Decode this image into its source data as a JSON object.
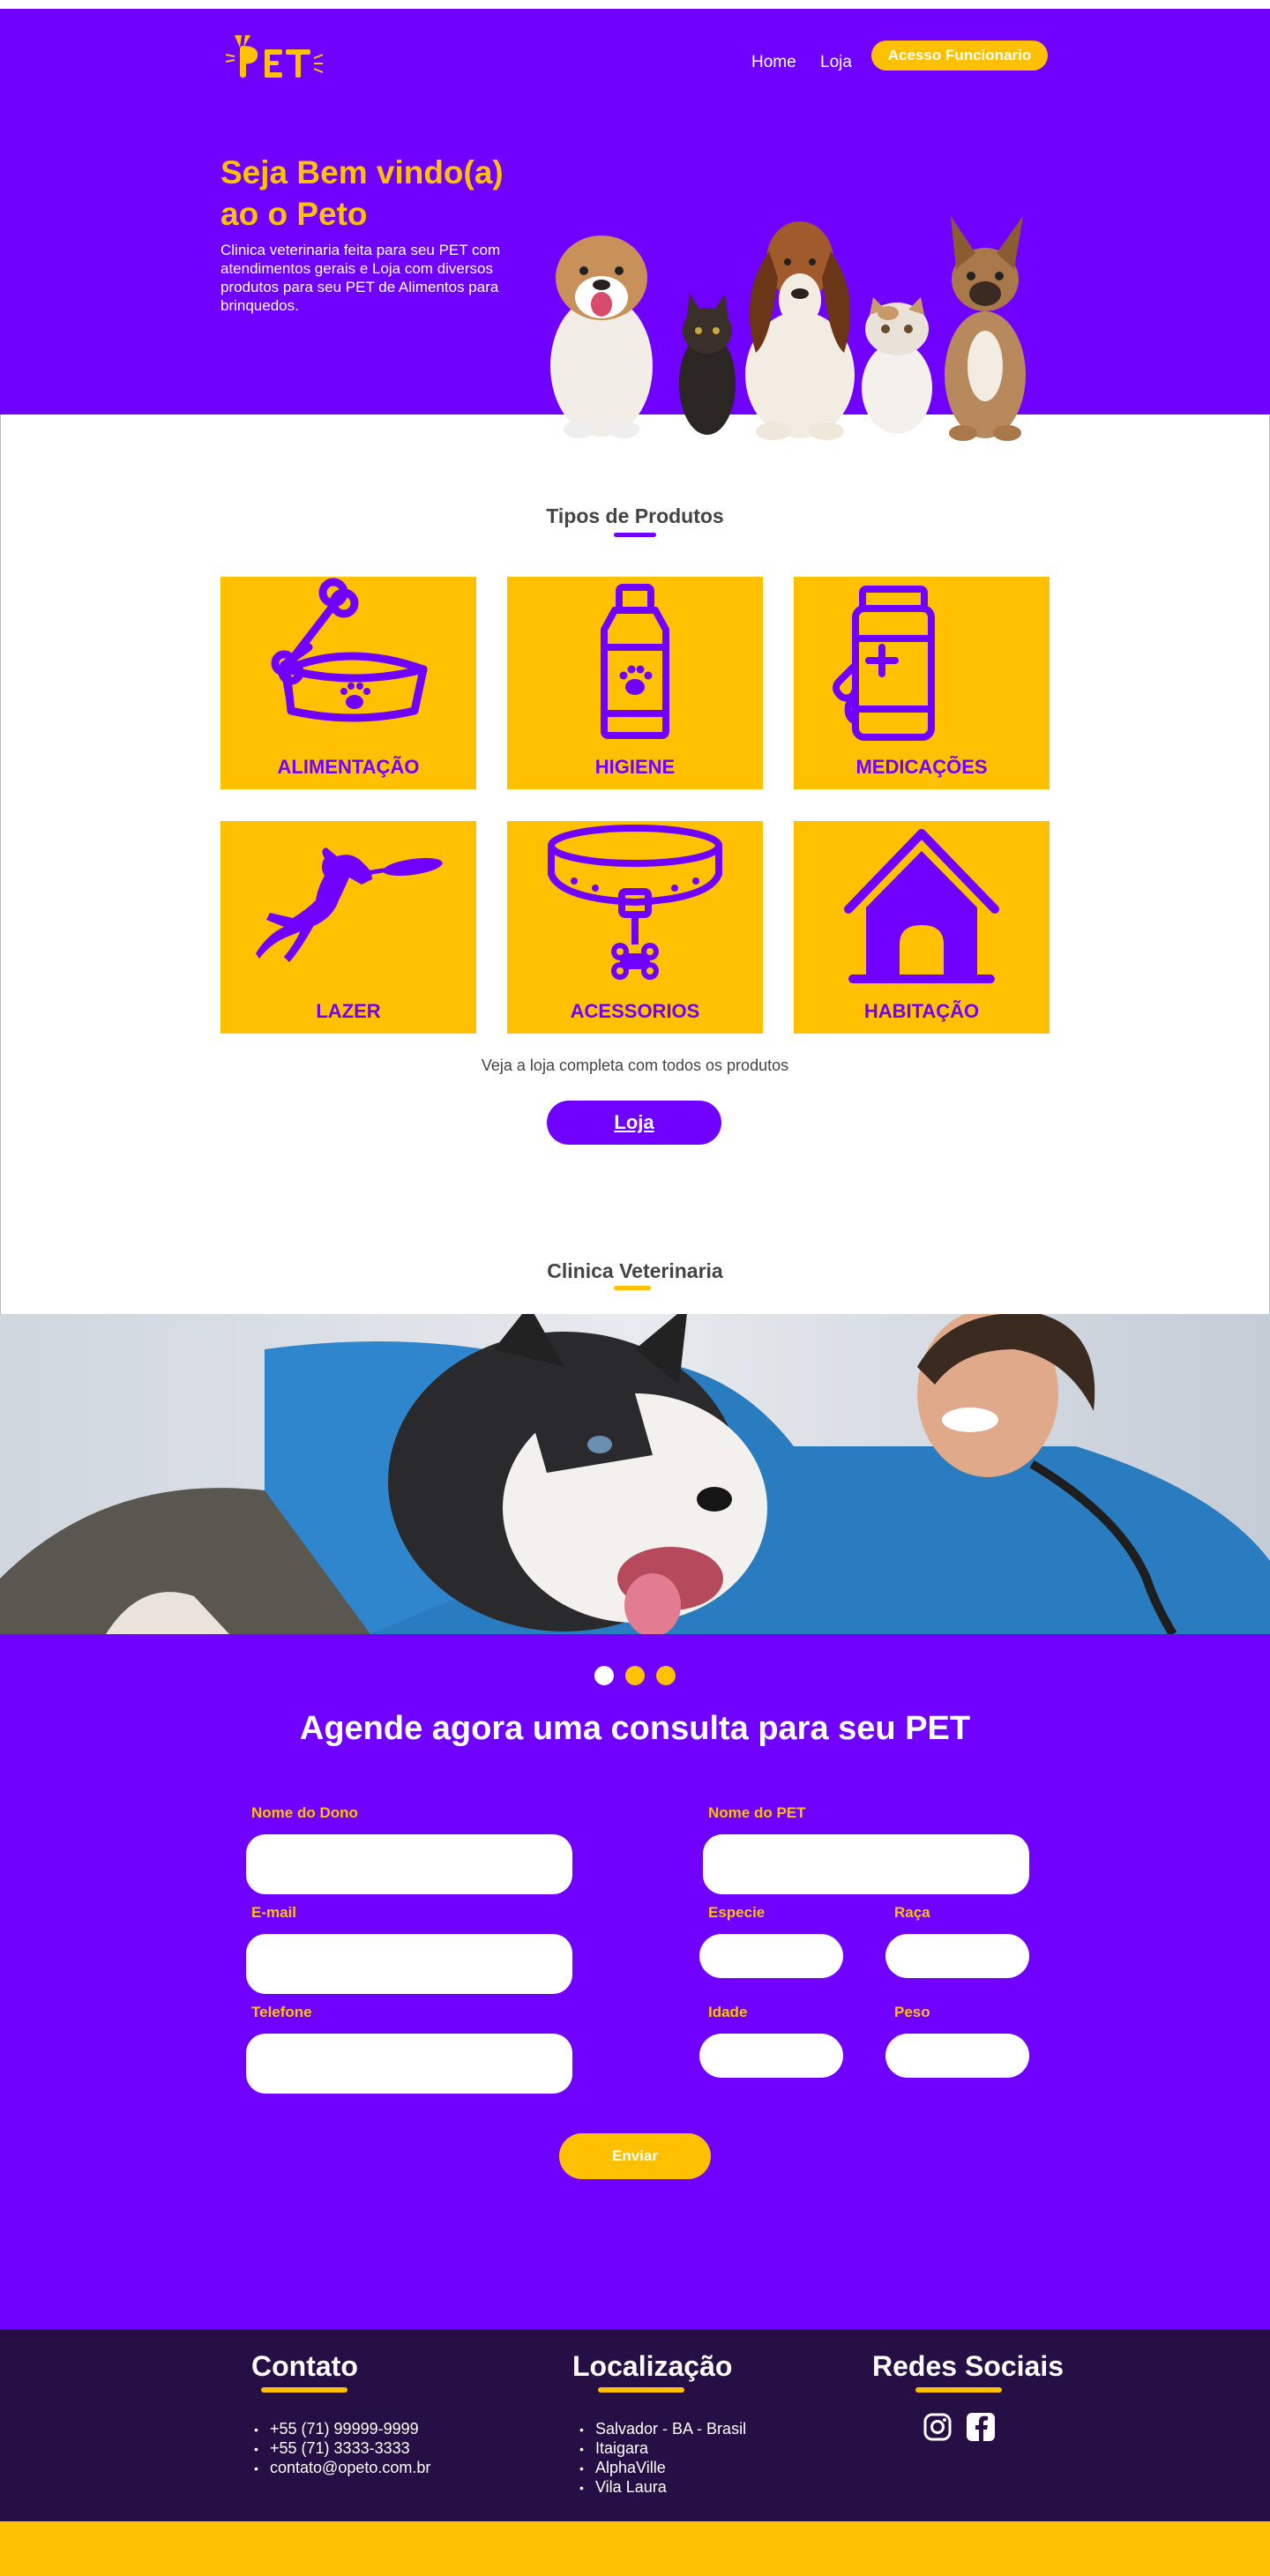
{
  "header": {
    "logo_text": "PET",
    "nav": {
      "home": "Home",
      "loja": "Loja",
      "staff": "Acesso Funcionario"
    }
  },
  "hero": {
    "title_line1": "Seja Bem vindo(a)",
    "title_line2": "ao o Peto",
    "description": "Clinica veterinaria feita para seu PET com atendimentos gerais e  Loja com diversos produtos para  seu PET de Alimentos para brinquedos."
  },
  "products": {
    "title": "Tipos de Produtos",
    "items": [
      {
        "label": "ALIMENTAÇÃO",
        "icon": "food-bowl-icon"
      },
      {
        "label": "HIGIENE",
        "icon": "shampoo-bottle-icon"
      },
      {
        "label": "MEDICAÇÕES",
        "icon": "medicine-bottle-icon"
      },
      {
        "label": "LAZER",
        "icon": "dog-frisbee-icon"
      },
      {
        "label": "ACESSORIOS",
        "icon": "dog-collar-icon"
      },
      {
        "label": "HABITAÇÃO",
        "icon": "dog-house-icon"
      }
    ],
    "shop_text": "Veja a loja completa com todos os produtos",
    "shop_button": "Loja"
  },
  "clinic": {
    "title": "Clinica Veterinaria"
  },
  "booking": {
    "title": "Agende agora uma consulta para seu PET",
    "carousel": {
      "count": 3,
      "active_index": 0
    },
    "labels": {
      "owner": "Nome do Dono",
      "email": "E-mail",
      "phone": "Telefone",
      "pet": "Nome do PET",
      "species": "Especie",
      "breed": "Raça",
      "age": "Idade",
      "weight": "Peso"
    },
    "submit": "Enviar"
  },
  "footer": {
    "contact": {
      "title": "Contato",
      "items": [
        "+55 (71) 99999-9999",
        "+55 (71) 3333-3333",
        "contato@opeto.com.br"
      ]
    },
    "location": {
      "title": "Localização",
      "items": [
        "Salvador - BA - Brasil",
        "Itaigara",
        "AlphaVille",
        "Vila Laura"
      ]
    },
    "social": {
      "title": "Redes Sociais",
      "icons": [
        "instagram-icon",
        "facebook-icon"
      ]
    }
  },
  "colors": {
    "purple": "#7000ff",
    "yellow": "#ffc000",
    "footer_dark": "#250f45",
    "text_gray": "#444444"
  }
}
